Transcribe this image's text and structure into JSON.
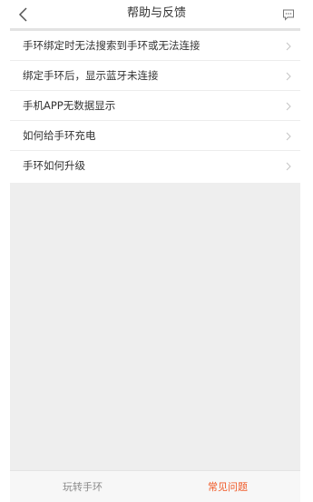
{
  "header": {
    "title": "帮助与反馈",
    "back_icon": "chevron-left-icon",
    "feedback_icon": "message-icon"
  },
  "faq": {
    "items": [
      {
        "label": "手环绑定时无法搜索到手环或无法连接"
      },
      {
        "label": "绑定手环后，显示蓝牙未连接"
      },
      {
        "label": "手机APP无数据显示"
      },
      {
        "label": "如何给手环充电"
      },
      {
        "label": "手环如何升级"
      }
    ]
  },
  "tabs": [
    {
      "label": "玩转手环",
      "active": false
    },
    {
      "label": "常见问题",
      "active": true
    }
  ],
  "colors": {
    "accent": "#f05a28",
    "inactive_tab": "#8a8a8a",
    "content_bg": "#eeeeee"
  }
}
